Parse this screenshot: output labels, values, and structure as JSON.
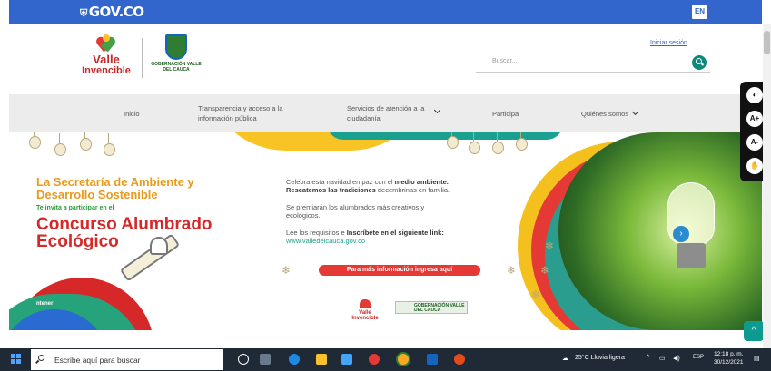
{
  "gov_bar": {
    "logo_text": "GOV.CO",
    "lang_button": "EN"
  },
  "header": {
    "logo_valle_line1": "Valle",
    "logo_valle_line2": "Invencible",
    "logo_gob_text": "GOBERNACIÓN VALLE DEL CAUCA",
    "login_link": "Iniciar sesión",
    "search_placeholder": "Buscar..."
  },
  "nav": {
    "items": [
      {
        "label": "Inicio"
      },
      {
        "label": "Transparencia y acceso a la información pública"
      },
      {
        "label": "Servicios de atención a la ciudadanía"
      },
      {
        "label": "Participa"
      },
      {
        "label": "Quiénes somos"
      }
    ]
  },
  "banner": {
    "secretaria": "La Secretaría de Ambiente y Desarrollo Sostenible",
    "invite": "Te invita a participar en el",
    "contest": "Concurso Alumbrado Ecológico",
    "line1_a": "Celebra esta navidad en paz con el ",
    "line1_b": "medio ambiente.",
    "line2_a": "Rescatemos las tradiciones",
    "line2_b": " decembrinas en familia.",
    "line3": "Se premiarán los alumbrados más creativos y ecológicos.",
    "line4_a": "Lee los requisitos e ",
    "line4_b": "Inscríbete en el siguiente link:",
    "link": "www.valledelcauca.gov.co",
    "cta": "Para más información ingresa aquí",
    "footer_logo1_line1": "Valle",
    "footer_logo1_line2": "Invencible",
    "footer_logo2": "GOBERNACIÓN VALLE DEL CAUCA",
    "cookie_text": "ntener",
    "next_button": "›"
  },
  "accessibility": {
    "contrast_icon": "contrast-icon",
    "increase_font": "A+",
    "decrease_font": "A-",
    "sign_language_icon": "sign-language-icon"
  },
  "back_to_top": "^",
  "taskbar": {
    "search_placeholder": "Escribe aquí para buscar",
    "weather": "25°C Lluvia ligera",
    "lang": "ESP",
    "time": "12:18 p. m.",
    "date": "30/12/2021"
  },
  "colors": {
    "gov_blue": "#3366cc",
    "accent_teal": "#0f8a7a",
    "contest_red": "#d62828",
    "secretaria_orange": "#e89a1c"
  }
}
